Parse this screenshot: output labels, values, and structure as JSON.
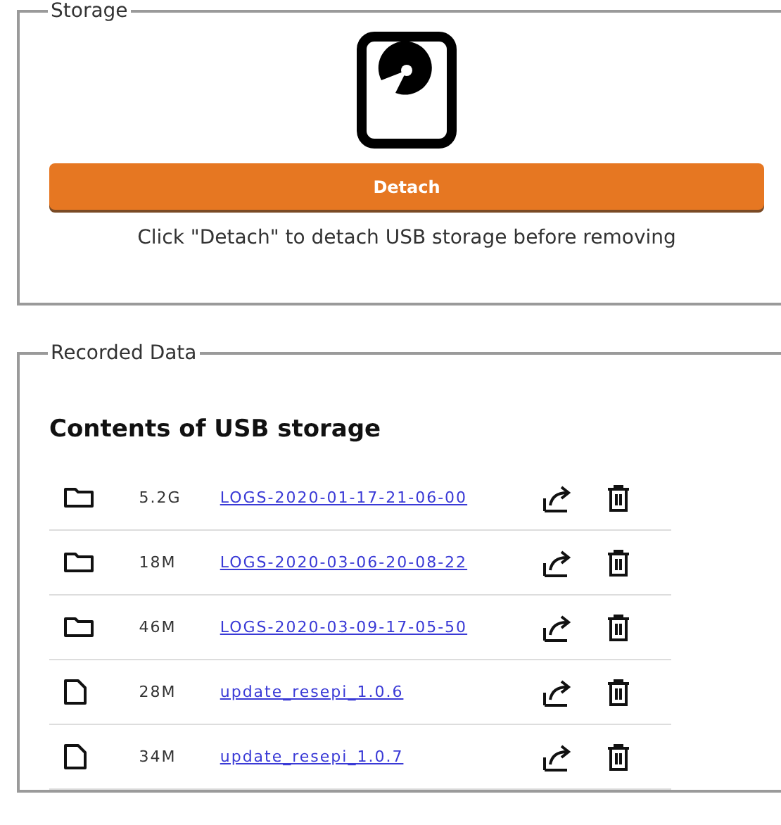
{
  "storage": {
    "legend": "Storage",
    "button": "Detach",
    "hint": "Click \"Detach\" to detach USB storage before removing"
  },
  "recorded": {
    "legend": "Recorded Data",
    "heading": "Contents of USB storage",
    "items": [
      {
        "kind": "folder",
        "size": "5.2G",
        "name": "LOGS-2020-01-17-21-06-00"
      },
      {
        "kind": "folder",
        "size": "18M",
        "name": "LOGS-2020-03-06-20-08-22"
      },
      {
        "kind": "folder",
        "size": "46M",
        "name": "LOGS-2020-03-09-17-05-50"
      },
      {
        "kind": "file",
        "size": "28M",
        "name": "update_resepi_1.0.6"
      },
      {
        "kind": "file",
        "size": "34M",
        "name": "update_resepi_1.0.7"
      }
    ]
  }
}
